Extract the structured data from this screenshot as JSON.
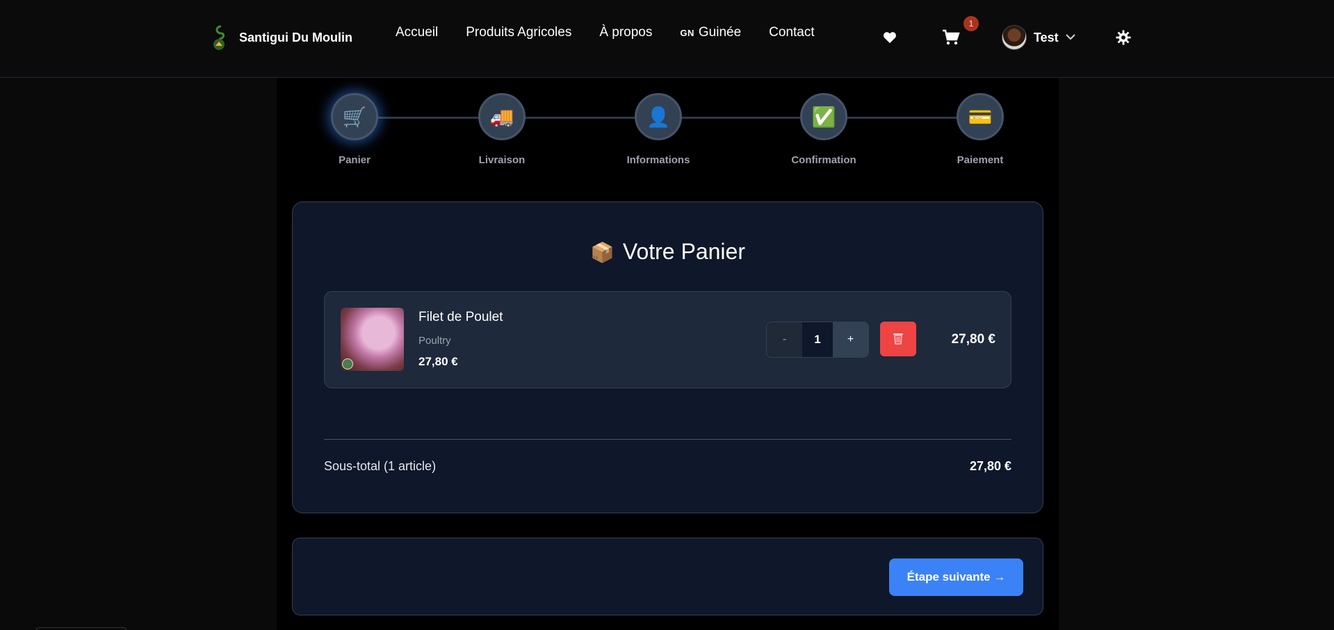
{
  "header": {
    "brand_name": "Santigui Du Moulin",
    "nav": [
      {
        "label": "Accueil"
      },
      {
        "label": "Produits Agricoles"
      },
      {
        "label": "À propos"
      },
      {
        "flag": "GN",
        "label": "Guinée"
      },
      {
        "label": "Contact"
      }
    ],
    "icons": [
      "heart-icon",
      "cart-icon",
      "gear-icon"
    ],
    "cart_count": "1",
    "user_name": "Test"
  },
  "stepper": {
    "steps": [
      {
        "label": "Panier",
        "icon": "🛒",
        "active": true
      },
      {
        "label": "Livraison",
        "icon": "🚚",
        "active": false
      },
      {
        "label": "Informations",
        "icon": "👤",
        "active": false
      },
      {
        "label": "Confirmation",
        "icon": "✅",
        "active": false
      },
      {
        "label": "Paiement",
        "icon": "💳",
        "active": false
      }
    ]
  },
  "cart": {
    "title": "Votre Panier",
    "title_icon": "📦",
    "items": [
      {
        "name": "Filet de Poulet",
        "category": "Poultry",
        "unit_price": "27,80 €",
        "quantity": "1",
        "minus_label": "-",
        "plus_label": "+",
        "line_total": "27,80 €"
      }
    ],
    "subtotal_label": "Sous-total (1 article)",
    "subtotal_value": "27,80 €"
  },
  "actions": {
    "next_label": "Étape suivante →"
  },
  "colors": {
    "accent": "#3b82f6",
    "danger": "#ef4444",
    "card_bg": "#0f172a",
    "badge": "#a8341f"
  }
}
